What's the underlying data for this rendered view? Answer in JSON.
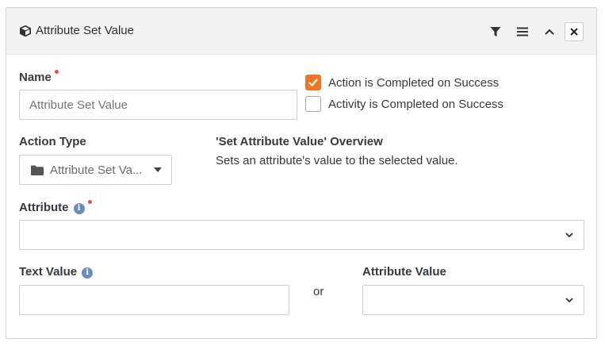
{
  "header": {
    "title": "Attribute Set Value",
    "buttons": {
      "filter": "filter-icon",
      "menu": "menu-icon",
      "collapse": "chevron-up-icon",
      "close": "close-icon"
    }
  },
  "form": {
    "name": {
      "label": "Name",
      "required": true,
      "value": "",
      "placeholder": "Attribute Set Value"
    },
    "checkboxes": [
      {
        "label": "Action is Completed on Success",
        "checked": true
      },
      {
        "label": "Activity is Completed on Success",
        "checked": false
      }
    ],
    "action_type": {
      "label": "Action Type",
      "selected": "Attribute Set Va..."
    },
    "overview": {
      "title": "'Set Attribute Value' Overview",
      "description": "Sets an attribute's value to the selected value."
    },
    "attribute": {
      "label": "Attribute",
      "required": true,
      "value": ""
    },
    "text_value": {
      "label": "Text Value",
      "value": ""
    },
    "or_text": "or",
    "attribute_value": {
      "label": "Attribute Value",
      "value": ""
    }
  },
  "colors": {
    "accent": "#ee7625",
    "required": "#d9534f",
    "info": "#6b8cbf"
  }
}
